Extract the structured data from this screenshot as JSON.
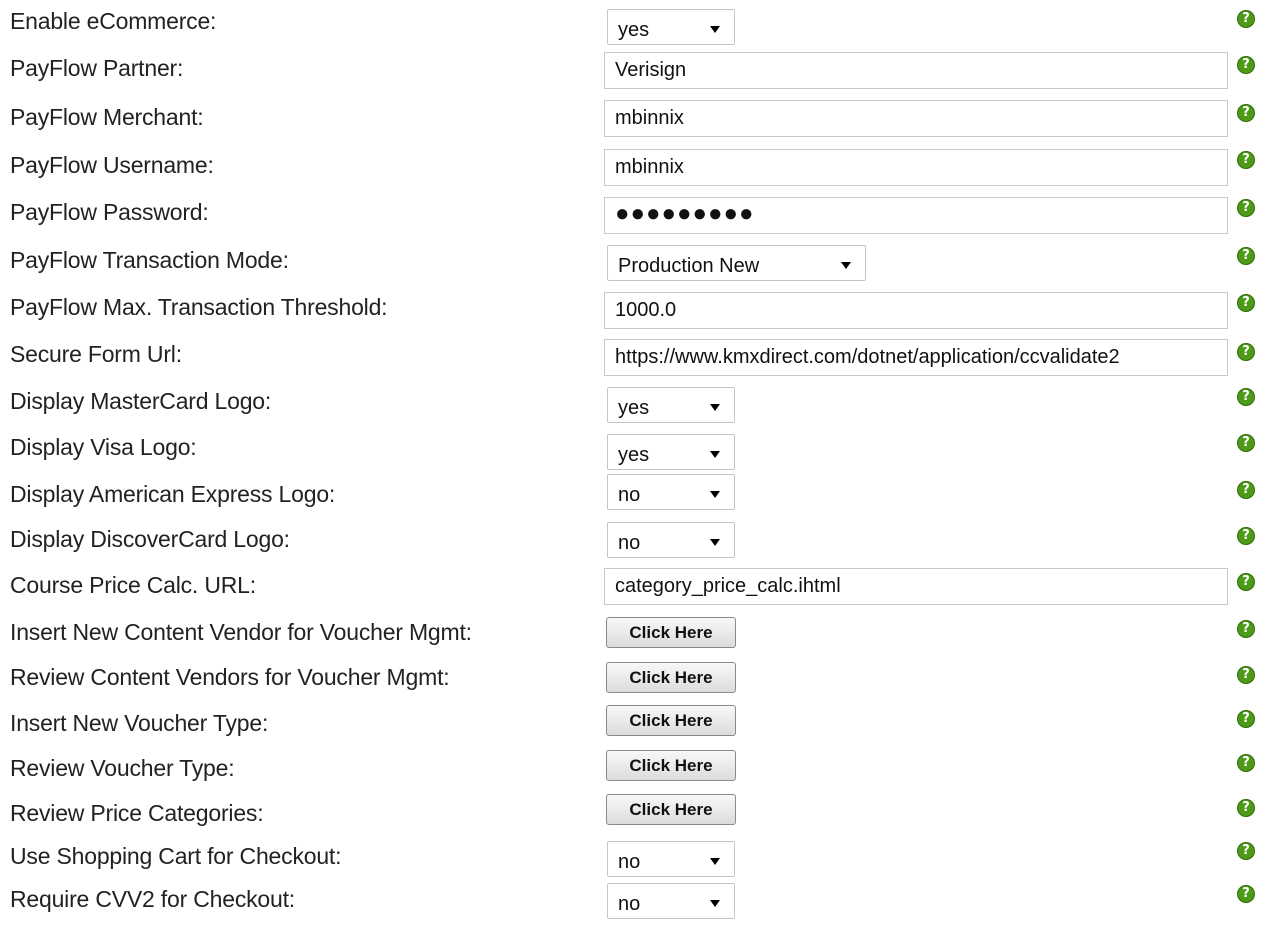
{
  "help_glyph": "?",
  "help_color": "#4d9a18",
  "rows": [
    {
      "label": "Enable eCommerce:",
      "type": "select",
      "value": "yes"
    },
    {
      "label": "PayFlow Partner:",
      "type": "text",
      "value": "Verisign"
    },
    {
      "label": "PayFlow Merchant:",
      "type": "text",
      "value": "mbinnix"
    },
    {
      "label": "PayFlow Username:",
      "type": "text",
      "value": "mbinnix"
    },
    {
      "label": "PayFlow Password:",
      "type": "password",
      "value": "●●●●●●●●●"
    },
    {
      "label": "PayFlow Transaction Mode:",
      "type": "select",
      "value": "Production New"
    },
    {
      "label": "PayFlow Max. Transaction Threshold:",
      "type": "text",
      "value": "1000.0"
    },
    {
      "label": "Secure Form Url:",
      "type": "text",
      "value": "https://www.kmxdirect.com/dotnet/application/ccvalidate2"
    },
    {
      "label": "Display MasterCard Logo:",
      "type": "select",
      "value": "yes"
    },
    {
      "label": "Display Visa Logo:",
      "type": "select",
      "value": "yes"
    },
    {
      "label": "Display American Express Logo:",
      "type": "select",
      "value": "no"
    },
    {
      "label": "Display DiscoverCard Logo:",
      "type": "select",
      "value": "no"
    },
    {
      "label": "Course Price Calc. URL:",
      "type": "text",
      "value": "category_price_calc.ihtml"
    },
    {
      "label": "Insert New Content Vendor for Voucher Mgmt:",
      "type": "button",
      "value": "Click Here"
    },
    {
      "label": "Review Content Vendors for Voucher Mgmt:",
      "type": "button",
      "value": "Click Here"
    },
    {
      "label": "Insert New Voucher Type:",
      "type": "button",
      "value": "Click Here"
    },
    {
      "label": "Review Voucher Type:",
      "type": "button",
      "value": "Click Here"
    },
    {
      "label": "Review Price Categories:",
      "type": "button",
      "value": "Click Here"
    },
    {
      "label": "Use Shopping Cart for Checkout:",
      "type": "select",
      "value": "no"
    },
    {
      "label": "Require CVV2 for Checkout:",
      "type": "select",
      "value": "no"
    }
  ]
}
